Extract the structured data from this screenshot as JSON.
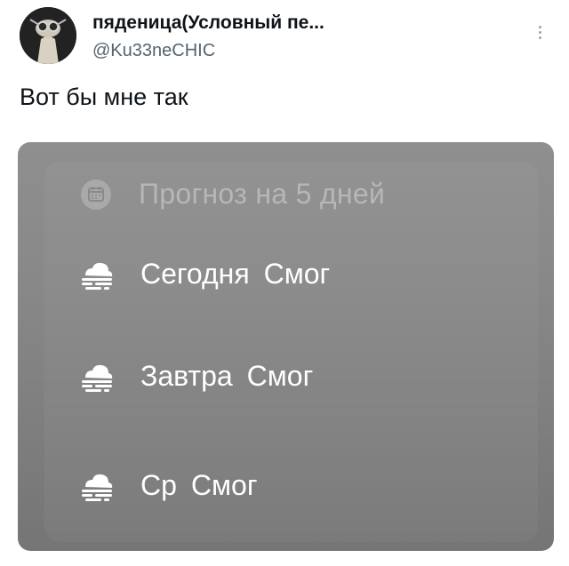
{
  "tweet": {
    "user_name": "пяденица(Условный пе...",
    "user_handle": "@Ku33neCHIC",
    "text": "Вот бы мне так"
  },
  "forecast": {
    "title": "Прогноз на 5 дней",
    "days": [
      {
        "day": "Сегодня",
        "condition": "Смог",
        "icon": "fog-cloud-icon"
      },
      {
        "day": "Завтра",
        "condition": "Смог",
        "icon": "fog-cloud-icon"
      },
      {
        "day": "Ср",
        "condition": "Смог",
        "icon": "fog-cloud-icon"
      }
    ]
  },
  "colors": {
    "text_primary": "#0f1419",
    "text_secondary": "#536471",
    "media_background": "#888888",
    "forecast_text": "#ffffff",
    "forecast_title": "#b7b7b7"
  }
}
